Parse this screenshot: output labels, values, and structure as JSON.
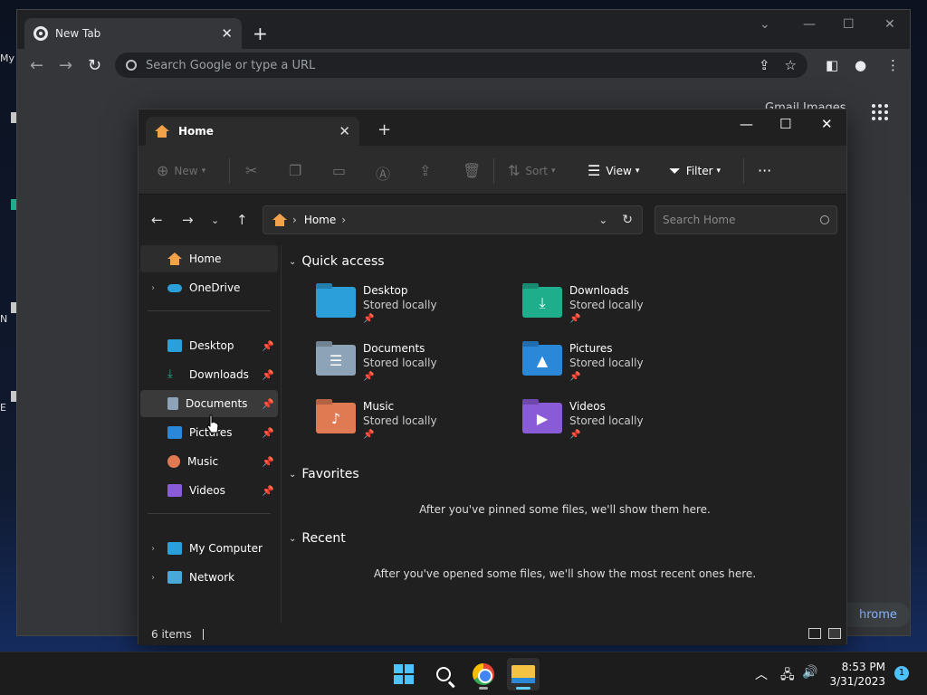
{
  "desktop": {
    "icon_labels": [
      "My",
      "N",
      "E"
    ]
  },
  "chrome": {
    "tab_title": "New Tab",
    "newtab_glyph": "+",
    "omnibox_placeholder": "Search Google or type a URL",
    "links": "Gmail   Images",
    "customize_label": "hrome"
  },
  "explorer": {
    "tab_title": "Home",
    "commands": {
      "new": "New",
      "sort": "Sort",
      "view": "View",
      "filter": "Filter",
      "more": "···"
    },
    "address": {
      "crumb": "Home"
    },
    "search_placeholder": "Search Home",
    "sidebar": {
      "home": "Home",
      "onedrive": "OneDrive",
      "desktop": "Desktop",
      "downloads": "Downloads",
      "documents": "Documents",
      "pictures": "Pictures",
      "music": "Music",
      "videos": "Videos",
      "my_computer": "My Computer",
      "network": "Network"
    },
    "quick_access": {
      "heading": "Quick access",
      "items": [
        {
          "name": "Desktop",
          "status": "Stored locally"
        },
        {
          "name": "Downloads",
          "status": "Stored locally"
        },
        {
          "name": "Documents",
          "status": "Stored locally"
        },
        {
          "name": "Pictures",
          "status": "Stored locally"
        },
        {
          "name": "Music",
          "status": "Stored locally"
        },
        {
          "name": "Videos",
          "status": "Stored locally"
        }
      ]
    },
    "favorites": {
      "heading": "Favorites",
      "empty": "After you've pinned some files, we'll show them here."
    },
    "recent": {
      "heading": "Recent",
      "empty": "After you've opened some files, we'll show the most recent ones here."
    },
    "status": "6 items"
  },
  "taskbar": {
    "time": "8:53 PM",
    "date": "3/31/2023",
    "notification_count": "1"
  },
  "colors": {
    "accent": "#60cdff",
    "home_orange": "#f3a14b",
    "folder_desktop": "#2b9fd9",
    "folder_downloads": "#1fae8c",
    "folder_documents": "#8da3b8",
    "folder_pictures": "#2b88d8",
    "folder_music": "#e07a52",
    "folder_videos": "#8a5bd6"
  }
}
